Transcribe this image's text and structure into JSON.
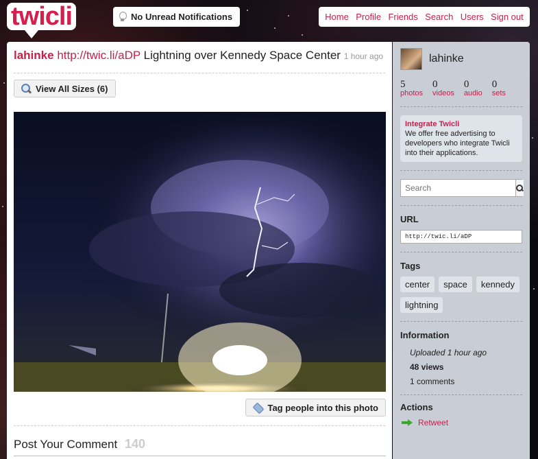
{
  "header": {
    "logo_text": "twicli",
    "notifications_label": "No Unread Notifications",
    "nav": [
      "Home",
      "Profile",
      "Friends",
      "Search",
      "Users",
      "Sign out"
    ]
  },
  "post": {
    "username": "lahinke",
    "short_url": "http://twic.li/aDP",
    "title": "Lightning over Kennedy Space Center",
    "age": "1 hour ago",
    "view_sizes_label": "View All Sizes (6)",
    "tag_people_label": "Tag people into this photo"
  },
  "comment": {
    "title": "Post Your Comment",
    "char_count": "140"
  },
  "sidebar": {
    "username": "lahinke",
    "stats": [
      {
        "num": "5",
        "label": "photos"
      },
      {
        "num": "0",
        "label": "videos"
      },
      {
        "num": "0",
        "label": "audio"
      },
      {
        "num": "0",
        "label": "sets"
      }
    ],
    "promo": {
      "title": "Integrate Twicli",
      "text": "We offer free advertising to developers who integrate Twicli into their applications."
    },
    "search_placeholder": "Search",
    "url_title": "URL",
    "url_value": "http://twic.li/aDP",
    "tags_title": "Tags",
    "tags": [
      "center",
      "space",
      "kennedy",
      "lightning"
    ],
    "info_title": "Information",
    "uploaded": "Uploaded 1 hour ago",
    "views": "48 views",
    "comments": "1 comments",
    "actions_title": "Actions",
    "retweet_label": "Retweet"
  },
  "colors": {
    "accent": "#c8204a",
    "sidebar_bg": "#c8cdd6"
  }
}
